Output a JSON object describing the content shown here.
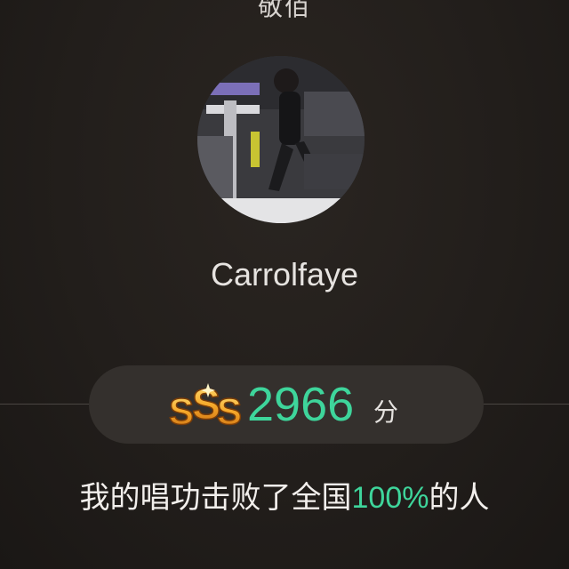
{
  "header": {
    "title": "敬佰"
  },
  "profile": {
    "username": "Carrolfaye",
    "avatar_icon": "user-photo"
  },
  "score": {
    "rank": "SSS",
    "value": "2966",
    "unit": "分",
    "accent_color": "#3ed59b",
    "rank_color": "#f4a52a"
  },
  "result": {
    "prefix": "我的唱功击败了全国",
    "percent": "100%",
    "suffix": "的人"
  }
}
